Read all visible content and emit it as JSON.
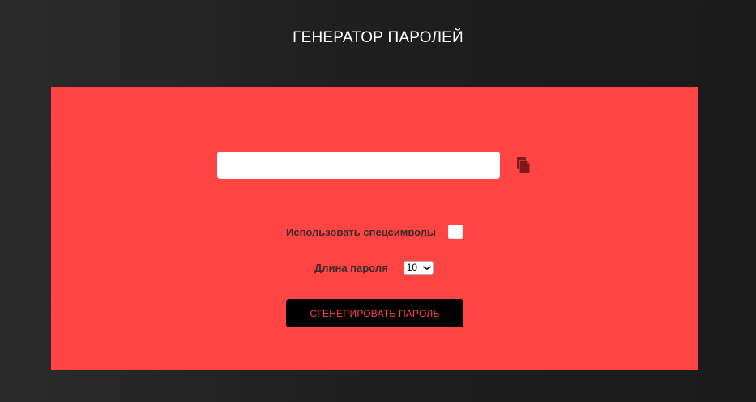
{
  "header": {
    "title": "ГЕНЕРАТОР ПАРОЛЕЙ"
  },
  "colors": {
    "panel": "#ff4444",
    "background": "#1f1f1f",
    "button_bg": "#000000",
    "button_text": "#ff4444"
  },
  "generator": {
    "password_value": "",
    "password_placeholder": "",
    "copy_icon": "copy-icon",
    "special_chars_label": "Использовать спецсимволы",
    "special_chars_checked": false,
    "length_label": "Длина пароля",
    "length_selected": "10",
    "generate_label": "СГЕНЕРИРОВАТЬ ПАРОЛЬ"
  }
}
